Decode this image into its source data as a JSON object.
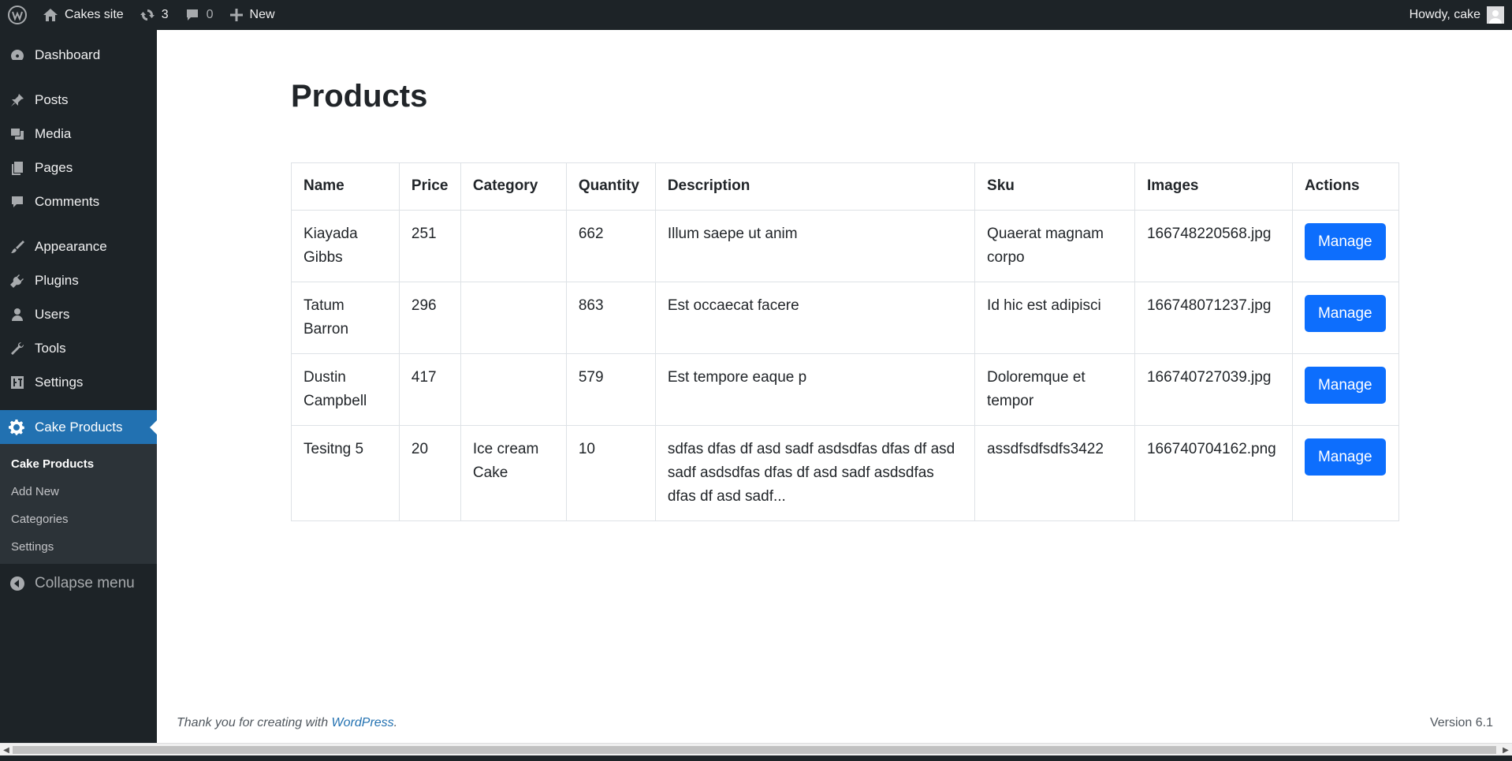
{
  "adminbar": {
    "site_name": "Cakes site",
    "updates_count": "3",
    "comments_count": "0",
    "new_label": "New",
    "howdy": "Howdy, cake"
  },
  "sidebar": {
    "items": [
      {
        "label": "Dashboard",
        "icon": "dashboard-icon"
      },
      {
        "label": "Posts",
        "icon": "pin-icon"
      },
      {
        "label": "Media",
        "icon": "media-icon"
      },
      {
        "label": "Pages",
        "icon": "pages-icon"
      },
      {
        "label": "Comments",
        "icon": "comment-icon"
      },
      {
        "label": "Appearance",
        "icon": "brush-icon"
      },
      {
        "label": "Plugins",
        "icon": "plugin-icon"
      },
      {
        "label": "Users",
        "icon": "user-icon"
      },
      {
        "label": "Tools",
        "icon": "wrench-icon"
      },
      {
        "label": "Settings",
        "icon": "settings-icon"
      },
      {
        "label": "Cake Products",
        "icon": "gear-icon"
      }
    ],
    "submenu": [
      "Cake Products",
      "Add New",
      "Categories",
      "Settings"
    ],
    "collapse_label": "Collapse menu"
  },
  "main": {
    "title": "Products",
    "columns": [
      "Name",
      "Price",
      "Category",
      "Quantity",
      "Description",
      "Sku",
      "Images",
      "Actions"
    ],
    "rows": [
      {
        "name": "Kiayada Gibbs",
        "price": "251",
        "category": "",
        "quantity": "662",
        "description": "Illum saepe ut anim",
        "sku": "Quaerat magnam corpo",
        "image": "166748220568.jpg",
        "action": "Manage"
      },
      {
        "name": "Tatum Barron",
        "price": "296",
        "category": "",
        "quantity": "863",
        "description": "Est occaecat facere",
        "sku": "Id hic est adipisci",
        "image": "166748071237.jpg",
        "action": "Manage"
      },
      {
        "name": "Dustin Campbell",
        "price": "417",
        "category": "",
        "quantity": "579",
        "description": "Est tempore eaque p",
        "sku": "Doloremque et tempor",
        "image": "166740727039.jpg",
        "action": "Manage"
      },
      {
        "name": "Tesitng 5",
        "price": "20",
        "category": "Ice cream Cake",
        "quantity": "10",
        "description": "sdfas dfas df asd sadf asdsdfas dfas df asd sadf asdsdfas dfas df asd sadf asdsdfas dfas df asd sadf...",
        "sku": "assdfsdfsdfs3422",
        "image": "166740704162.png",
        "action": "Manage"
      }
    ]
  },
  "footer": {
    "thanks_prefix": "Thank you for creating with ",
    "link_text": "WordPress",
    "thanks_suffix": ".",
    "version": "Version 6.1"
  },
  "colors": {
    "admin_bg": "#1d2327",
    "accent": "#2271b1",
    "button": "#0d6efd"
  }
}
